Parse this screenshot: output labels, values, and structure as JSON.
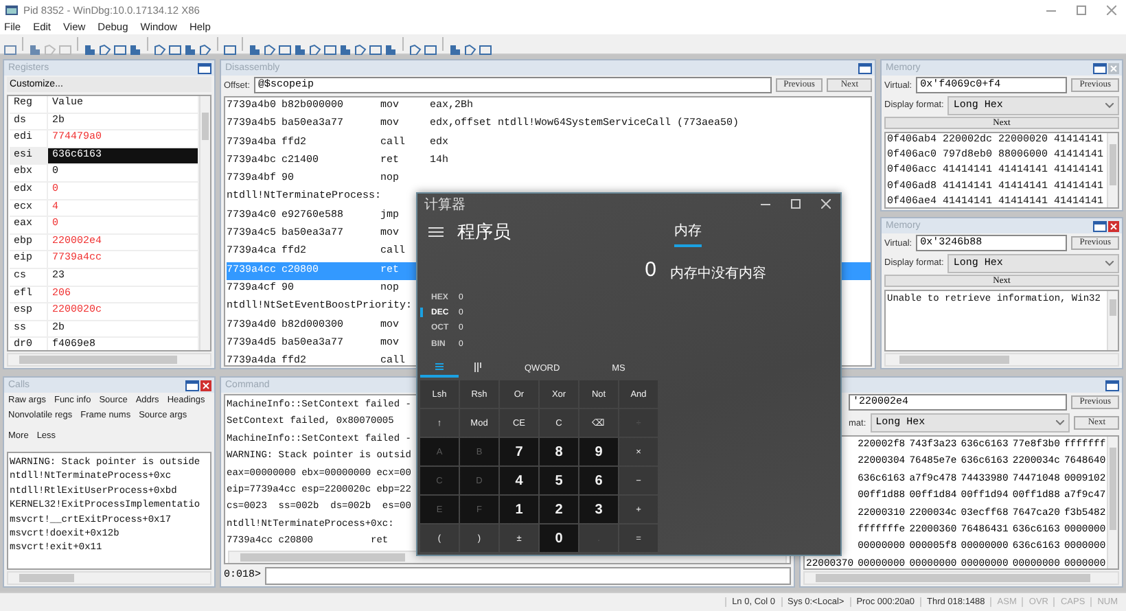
{
  "window": {
    "title": "Pid 8352 - WinDbg:10.0.17134.12 X86"
  },
  "menu": [
    "File",
    "Edit",
    "View",
    "Debug",
    "Window",
    "Help"
  ],
  "registers": {
    "title": "Registers",
    "customize": "Customize...",
    "columns": [
      "Reg",
      "Value"
    ],
    "rows": [
      {
        "name": "ds",
        "value": "2b",
        "changed": false,
        "selected": false
      },
      {
        "name": "edi",
        "value": "774479a0",
        "changed": true,
        "selected": false
      },
      {
        "name": "esi",
        "value": "636c6163",
        "changed": false,
        "selected": true
      },
      {
        "name": "ebx",
        "value": "0",
        "changed": false,
        "selected": false
      },
      {
        "name": "edx",
        "value": "0",
        "changed": true,
        "selected": false
      },
      {
        "name": "ecx",
        "value": "4",
        "changed": true,
        "selected": false
      },
      {
        "name": "eax",
        "value": "0",
        "changed": true,
        "selected": false
      },
      {
        "name": "ebp",
        "value": "220002e4",
        "changed": true,
        "selected": false
      },
      {
        "name": "eip",
        "value": "7739a4cc",
        "changed": true,
        "selected": false
      },
      {
        "name": "cs",
        "value": "23",
        "changed": false,
        "selected": false
      },
      {
        "name": "efl",
        "value": "206",
        "changed": true,
        "selected": false
      },
      {
        "name": "esp",
        "value": "2200020c",
        "changed": true,
        "selected": false
      },
      {
        "name": "ss",
        "value": "2b",
        "changed": false,
        "selected": false
      },
      {
        "name": "dr0",
        "value": "f4069e8",
        "changed": false,
        "selected": false
      }
    ]
  },
  "disassembly": {
    "title": "Disassembly",
    "offset_label": "Offset:",
    "offset": "@$scopeip",
    "previous": "Previous",
    "next": "Next",
    "lines": [
      {
        "kind": "instr",
        "address": "7739a4b0",
        "bytes": "b82b000000",
        "mnemonic": "mov",
        "operands": "eax,2Bh",
        "selected": false
      },
      {
        "kind": "instr",
        "address": "7739a4b5",
        "bytes": "ba50ea3a77",
        "mnemonic": "mov",
        "operands": "edx,offset ntdll!Wow64SystemServiceCall (773aea50)",
        "selected": false
      },
      {
        "kind": "instr",
        "address": "7739a4ba",
        "bytes": "ffd2",
        "mnemonic": "call",
        "operands": "edx",
        "selected": false
      },
      {
        "kind": "instr",
        "address": "7739a4bc",
        "bytes": "c21400",
        "mnemonic": "ret",
        "operands": "14h",
        "selected": false
      },
      {
        "kind": "instr",
        "address": "7739a4bf",
        "bytes": "90",
        "mnemonic": "nop",
        "selected": false
      },
      {
        "kind": "label",
        "text": "ntdll!NtTerminateProcess:",
        "selected": false
      },
      {
        "kind": "instr",
        "address": "7739a4c0",
        "bytes": "e92760e588",
        "mnemonic": "jmp",
        "selected": false
      },
      {
        "kind": "instr",
        "address": "7739a4c5",
        "bytes": "ba50ea3a77",
        "mnemonic": "mov",
        "selected": false
      },
      {
        "kind": "instr",
        "address": "7739a4ca",
        "bytes": "ffd2",
        "mnemonic": "call",
        "selected": false
      },
      {
        "kind": "instr",
        "address": "7739a4cc",
        "bytes": "c20800",
        "mnemonic": "ret",
        "selected": true
      },
      {
        "kind": "instr",
        "address": "7739a4cf",
        "bytes": "90",
        "mnemonic": "nop",
        "selected": false
      },
      {
        "kind": "label",
        "text": "ntdll!NtSetEventBoostPriority:",
        "selected": false
      },
      {
        "kind": "instr",
        "address": "7739a4d0",
        "bytes": "b82d000300",
        "mnemonic": "mov",
        "selected": false
      },
      {
        "kind": "instr",
        "address": "7739a4d5",
        "bytes": "ba50ea3a77",
        "mnemonic": "mov",
        "selected": false
      },
      {
        "kind": "instr",
        "address": "7739a4da",
        "bytes": "ffd2",
        "mnemonic": "call",
        "selected": false
      }
    ]
  },
  "memory_top": {
    "title": "Memory",
    "active": false,
    "virtual_label": "Virtual:",
    "virtual": "0x'f4069c0+f4",
    "previous": "Previous",
    "format_label": "Display format:",
    "format": "Long Hex",
    "next": "Next",
    "rows": [
      "0f406ab4 220002dc 22000020 41414141",
      "0f406ac0 797d8eb0 88006000 41414141",
      "0f406acc 41414141 41414141 41414141",
      "0f406ad8 41414141 41414141 41414141",
      "0f406ae4 41414141 41414141 41414141"
    ]
  },
  "memory_middle": {
    "title": "Memory",
    "active": true,
    "virtual_label": "Virtual:",
    "virtual": "0x'3246b88",
    "previous": "Previous",
    "format_label": "Display format:",
    "format": "Long Hex",
    "next": "Next",
    "text": "Unable to retrieve information, Win32"
  },
  "calls": {
    "title": "Calls",
    "active": true,
    "options": [
      [
        "Raw args",
        "Func info",
        "Source",
        "Addrs",
        "Headings"
      ],
      [
        "Nonvolatile regs",
        "Frame nums",
        "Source args"
      ],
      [
        "More",
        "Less"
      ]
    ],
    "lines": [
      "WARNING: Stack pointer is outside",
      "ntdll!NtTerminateProcess+0xc",
      "ntdll!RtlExitUserProcess+0xbd",
      "KERNEL32!ExitProcessImplementatio",
      "msvcrt!__crtExitProcess+0x17",
      "msvcrt!doexit+0x12b",
      "msvcrt!exit+0x11"
    ]
  },
  "command": {
    "title": "Command",
    "lines": [
      "MachineInfo::SetContext failed -",
      "SetContext failed, 0x80070005",
      "MachineInfo::SetContext failed -",
      "WARNING: Stack pointer is outsid",
      "eax=00000000 ebx=00000000 ecx=00",
      "eip=7739a4cc esp=2200020c ebp=22",
      "cs=0023  ss=002b  ds=002b  es=00",
      "ntdll!NtTerminateProcess+0xc:",
      "7739a4cc c20800          ret"
    ],
    "prompt": "0:018>"
  },
  "memory_bottom": {
    "virtual": "'220002e4",
    "format_label": "mat:",
    "format": "Long Hex",
    "previous": "Previous",
    "next": "Next",
    "rows": [
      {
        "values": [
          "220002f8",
          "743f3a23",
          "636c6163",
          "77e8f3b0",
          "fffffff"
        ]
      },
      {
        "values": [
          "22000304",
          "76485e7e",
          "636c6163",
          "2200034c",
          "7648640"
        ]
      },
      {
        "values": [
          "636c6163",
          "a7f9c478",
          "74433980",
          "74471048",
          "0009102"
        ]
      },
      {
        "values": [
          "00ff1d88",
          "00ff1d84",
          "00ff1d94",
          "00ff1d88",
          "a7f9c47"
        ]
      },
      {
        "values": [
          "22000310",
          "2200034c",
          "03ecff68",
          "7647ca20",
          "f3b5482"
        ]
      },
      {
        "values": [
          "fffffffe",
          "22000360",
          "76486431",
          "636c6163",
          "0000000"
        ]
      },
      {
        "values": [
          "00000000",
          "000005f8",
          "00000000",
          "636c6163",
          "0000000"
        ]
      },
      {
        "address": "22000370",
        "values": [
          "00000000",
          "00000000",
          "00000000",
          "00000000",
          "0000000"
        ]
      }
    ]
  },
  "status_bar": [
    {
      "text": "Ln 0, Col 0",
      "on": true
    },
    {
      "text": "Sys 0:<Local>",
      "on": true
    },
    {
      "text": "Proc 000:20a0",
      "on": true
    },
    {
      "text": "Thrd 018:1488",
      "on": true
    },
    {
      "text": "ASM",
      "on": false
    },
    {
      "text": "OVR",
      "on": false
    },
    {
      "text": "CAPS",
      "on": false
    },
    {
      "text": "NUM",
      "on": false
    }
  ],
  "calculator": {
    "title": "计算器",
    "mode": "程序员",
    "memory_tab": "内存",
    "memory_empty": "内存中没有内容",
    "display": "0",
    "radix": [
      {
        "label": "HEX",
        "value": "0",
        "selected": false
      },
      {
        "label": "DEC",
        "value": "0",
        "selected": true
      },
      {
        "label": "OCT",
        "value": "0",
        "selected": false
      },
      {
        "label": "BIN",
        "value": "0",
        "selected": false
      }
    ],
    "tabs": [
      {
        "kind": "keypad",
        "selected": true
      },
      {
        "kind": "bits",
        "selected": false
      }
    ],
    "word_size": "QWORD",
    "memory_store": "MS",
    "keys": [
      {
        "label": "Lsh",
        "kind": "op",
        "disabled": false
      },
      {
        "label": "Rsh",
        "kind": "op",
        "disabled": false
      },
      {
        "label": "Or",
        "kind": "op",
        "disabled": false
      },
      {
        "label": "Xor",
        "kind": "op",
        "disabled": false
      },
      {
        "label": "Not",
        "kind": "op",
        "disabled": false
      },
      {
        "label": "And",
        "kind": "op",
        "disabled": false
      },
      {
        "label": "↑",
        "kind": "op",
        "disabled": false
      },
      {
        "label": "Mod",
        "kind": "op",
        "disabled": false
      },
      {
        "label": "CE",
        "kind": "op",
        "disabled": false
      },
      {
        "label": "C",
        "kind": "op",
        "disabled": false
      },
      {
        "label": "⌫",
        "kind": "op",
        "disabled": false
      },
      {
        "label": "÷",
        "kind": "op",
        "disabled": true
      },
      {
        "label": "A",
        "kind": "digit",
        "disabled": true
      },
      {
        "label": "B",
        "kind": "digit",
        "disabled": true
      },
      {
        "label": "7",
        "kind": "digit",
        "disabled": false
      },
      {
        "label": "8",
        "kind": "digit",
        "disabled": false
      },
      {
        "label": "9",
        "kind": "digit",
        "disabled": false
      },
      {
        "label": "×",
        "kind": "op",
        "disabled": false
      },
      {
        "label": "C",
        "kind": "digit",
        "disabled": true
      },
      {
        "label": "D",
        "kind": "digit",
        "disabled": true
      },
      {
        "label": "4",
        "kind": "digit",
        "disabled": false
      },
      {
        "label": "5",
        "kind": "digit",
        "disabled": false
      },
      {
        "label": "6",
        "kind": "digit",
        "disabled": false
      },
      {
        "label": "−",
        "kind": "op",
        "disabled": false
      },
      {
        "label": "E",
        "kind": "digit",
        "disabled": true
      },
      {
        "label": "F",
        "kind": "digit",
        "disabled": true
      },
      {
        "label": "1",
        "kind": "digit",
        "disabled": false
      },
      {
        "label": "2",
        "kind": "digit",
        "disabled": false
      },
      {
        "label": "3",
        "kind": "digit",
        "disabled": false
      },
      {
        "label": "+",
        "kind": "op",
        "disabled": false
      },
      {
        "label": "(",
        "kind": "op",
        "disabled": false
      },
      {
        "label": ")",
        "kind": "op",
        "disabled": false
      },
      {
        "label": "±",
        "kind": "op",
        "disabled": false
      },
      {
        "label": "0",
        "kind": "digit",
        "disabled": false
      },
      {
        "label": ".",
        "kind": "op",
        "disabled": true
      },
      {
        "label": "=",
        "kind": "op",
        "disabled": false
      }
    ]
  }
}
